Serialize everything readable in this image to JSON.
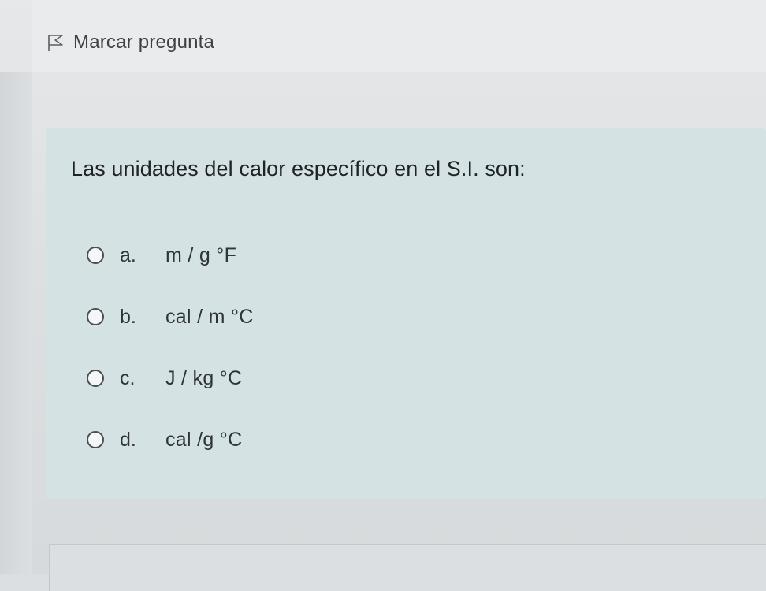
{
  "flag": {
    "label": "Marcar pregunta",
    "icon": "flag-outline-icon"
  },
  "question": {
    "text": "Las unidades del calor específico en el S.I. son:",
    "answers": [
      {
        "letter": "a.",
        "text": "m / g °F",
        "selected": false
      },
      {
        "letter": "b.",
        "text": "cal / m °C",
        "selected": false
      },
      {
        "letter": "c.",
        "text": "J / kg °C",
        "selected": false
      },
      {
        "letter": "d.",
        "text": "cal /g °C",
        "selected": false
      }
    ]
  },
  "colors": {
    "panel_background": "#d5e2e4",
    "page_background": "#dcdfe1",
    "text": "#1f2326"
  }
}
